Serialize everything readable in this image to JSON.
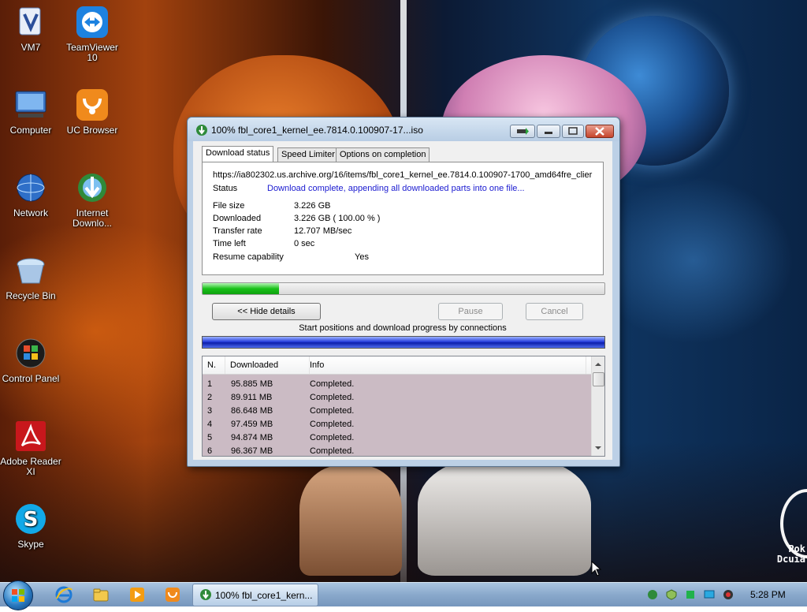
{
  "desktop": {
    "icons": [
      {
        "label": "VM7",
        "icon": "vm7-icon"
      },
      {
        "label": "TeamViewer 10",
        "icon": "teamviewer-icon"
      },
      {
        "label": "Computer",
        "icon": "computer-icon"
      },
      {
        "label": "UC Browser",
        "icon": "uc-browser-icon"
      },
      {
        "label": "Network",
        "icon": "network-icon"
      },
      {
        "label": "Internet Downlo...",
        "icon": "idm-icon"
      },
      {
        "label": "Recycle Bin",
        "icon": "recycle-bin-icon"
      },
      {
        "label": "Control Panel",
        "icon": "control-panel-icon"
      },
      {
        "label": "Adobe Reader XI",
        "icon": "adobe-reader-icon"
      },
      {
        "label": "Skype",
        "icon": "skype-icon"
      }
    ],
    "wallpaper_logo_text": [
      "Pok",
      "Dcuia"
    ]
  },
  "window": {
    "title": "100% fbl_core1_kernel_ee.7814.0.100907-17...iso",
    "tabs": [
      "Download status",
      "Speed Limiter",
      "Options on completion"
    ],
    "active_tab": 0,
    "url": "https://ia802302.us.archive.org/16/items/fbl_core1_kernel_ee.7814.0.100907-1700_amd64fre_clier",
    "status_label": "Status",
    "status_value": "Download complete, appending all downloaded parts into one file...",
    "fields": [
      {
        "label": "File size",
        "value": "3.226  GB"
      },
      {
        "label": "Downloaded",
        "value": "3.226  GB  ( 100.00 % )"
      },
      {
        "label": "Transfer rate",
        "value": "12.707  MB/sec"
      },
      {
        "label": "Time left",
        "value": "0 sec"
      },
      {
        "label": "Resume capability",
        "value": "Yes"
      }
    ],
    "main_progress": 0.19,
    "buttons": {
      "hide_details": "<< Hide details",
      "pause": "Pause",
      "cancel": "Cancel"
    },
    "connections_caption": "Start positions and download progress by connections",
    "connections_progress": 1.0,
    "list": {
      "headers": [
        "N.",
        "Downloaded",
        "Info"
      ],
      "rows": [
        {
          "n": "1",
          "downloaded": "95.885  MB",
          "info": "Completed."
        },
        {
          "n": "2",
          "downloaded": "89.911  MB",
          "info": "Completed."
        },
        {
          "n": "3",
          "downloaded": "86.648  MB",
          "info": "Completed."
        },
        {
          "n": "4",
          "downloaded": "97.459  MB",
          "info": "Completed."
        },
        {
          "n": "5",
          "downloaded": "94.874  MB",
          "info": "Completed."
        },
        {
          "n": "6",
          "downloaded": "96.367  MB",
          "info": "Completed."
        }
      ]
    }
  },
  "taskbar": {
    "task_label": "100% fbl_core1_kern...",
    "clock": "5:28 PM",
    "pinned": [
      "internet-explorer-icon",
      "windows-explorer-icon",
      "media-player-icon",
      "uc-browser-icon"
    ],
    "tray": [
      "network-tray-icon",
      "security-tray-icon",
      "green-tray-icon",
      "display-tray-icon",
      "speaker-tray-icon"
    ]
  },
  "colors": {
    "status_blue": "#1a1ad0",
    "progress_green": "#19c119",
    "connections_blue": "#1a2fd0",
    "list_rows_bg": "#cbbbc4"
  }
}
